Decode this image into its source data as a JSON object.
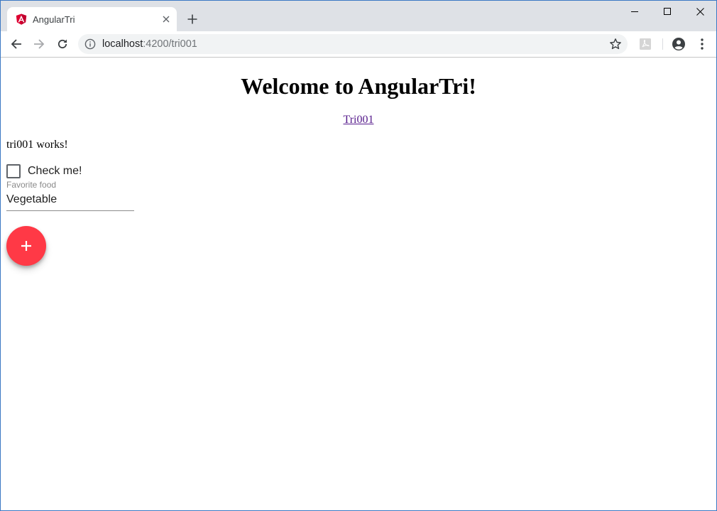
{
  "browser": {
    "tab": {
      "title": "AngularTri",
      "favicon": "angular-logo-icon"
    },
    "address_bar": {
      "host": "localhost",
      "path": ":4200/tri001"
    },
    "colors": {
      "tabstrip": "#dee1e6",
      "omnibox": "#f1f3f4"
    }
  },
  "page": {
    "title": "Welcome to AngularTri!",
    "nav_link": "Tri001",
    "works_text": "tri001 works!",
    "checkbox": {
      "label": "Check me!",
      "checked": false
    },
    "select": {
      "label": "Favorite food",
      "value": "Vegetable"
    },
    "fab": {
      "icon": "plus-icon",
      "color": "#ff3946"
    }
  }
}
